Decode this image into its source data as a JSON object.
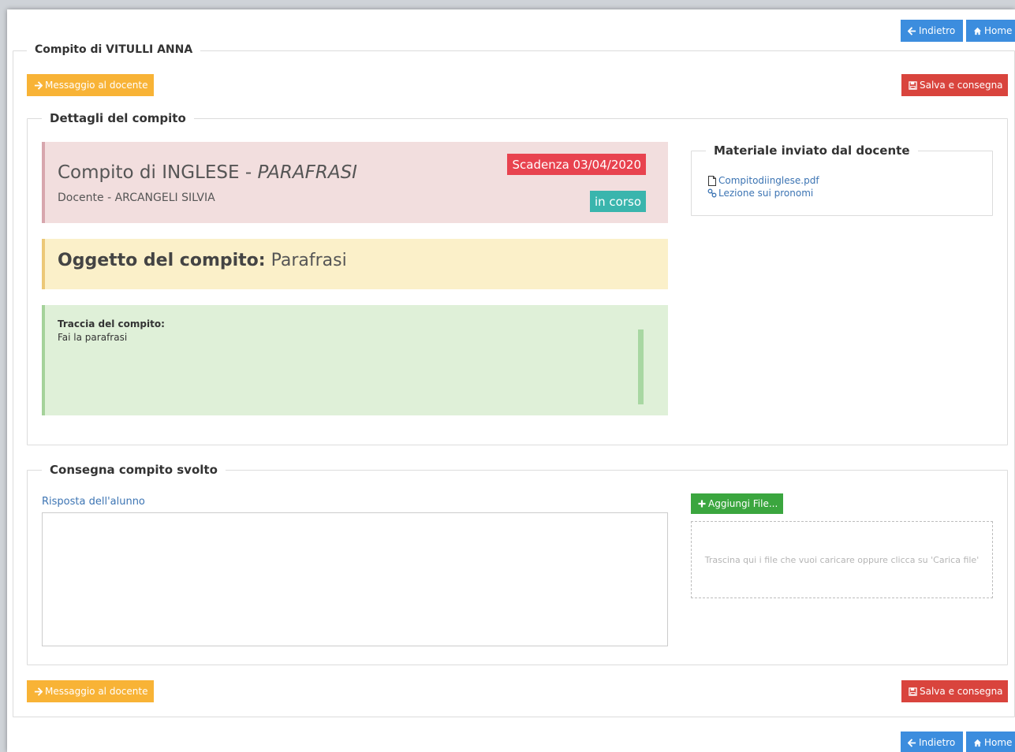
{
  "nav": {
    "back_label": "Indietro",
    "home_label": "Home"
  },
  "header": {
    "title": "Compito di VITULLI ANNA"
  },
  "actions": {
    "message_label": "Messaggio al docente",
    "save_label": "Salva e consegna"
  },
  "details": {
    "legend": "Dettagli del compito",
    "subject_prefix": "Compito di INGLESE - ",
    "subject_topic": "PARAFRASI",
    "teacher": "Docente - ARCANGELI SILVIA",
    "deadline": "Scadenza 03/04/2020",
    "status": "in corso",
    "object_label": "Oggetto del compito:",
    "object_value": "Parafrasi",
    "trace_label": "Traccia del compito:",
    "trace_value": "Fai la parafrasi"
  },
  "material": {
    "legend": "Materiale inviato dal docente",
    "items": [
      {
        "label": "Compitodiinglese.pdf",
        "icon": "file-icon"
      },
      {
        "label": "Lezione sui pronomi",
        "icon": "link-icon"
      }
    ]
  },
  "delivery": {
    "legend": "Consegna compito svolto",
    "answer_label": "Risposta dell'alunno",
    "answer_value": "",
    "add_file_label": "Aggiungi File...",
    "dropzone_text": "Trascina qui i file che vuoi caricare oppure clicca su 'Carica file'"
  },
  "colors": {
    "blue": "#3c8dde",
    "orange": "#f8b336",
    "red": "#d9443d",
    "green": "#3ba63f",
    "deadline_badge": "#e8434f",
    "status_badge": "#3ab5ad"
  }
}
